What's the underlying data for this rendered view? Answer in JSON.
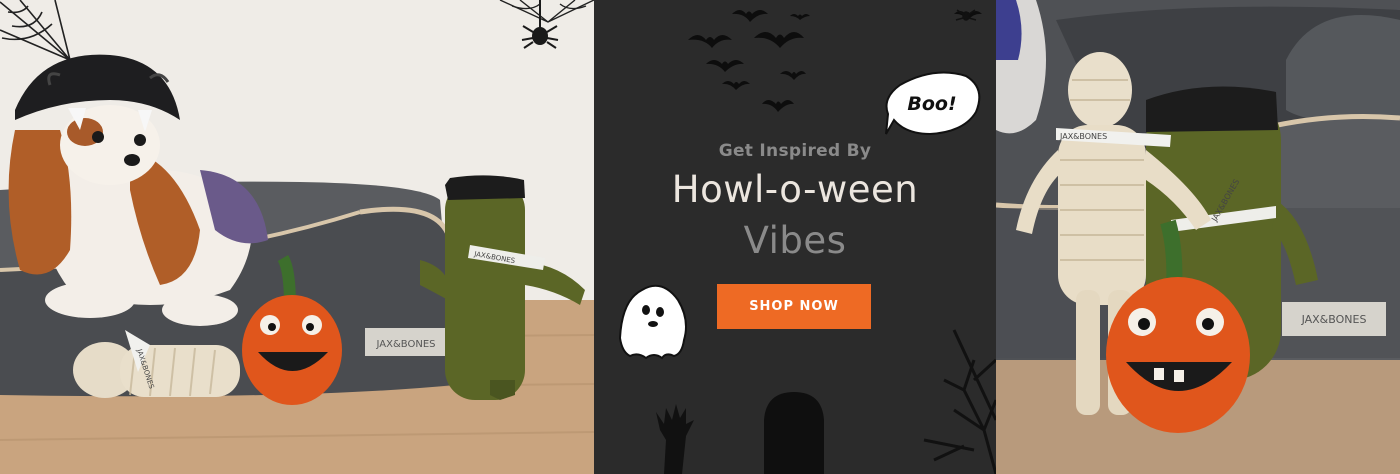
{
  "hero": {
    "eyebrow": "Get Inspired By",
    "title_line1": "Howl-o-ween",
    "title_line2": "Vibes",
    "cta_label": "SHOP NOW"
  },
  "boo_bubble": {
    "text": "Boo!"
  },
  "brand_tags": {
    "bed_left": "JAX&BONES",
    "ribbon_frank": "JAX&BONES",
    "ribbon_mummy_left": "JAX&BONES",
    "ribbon_mummy_right": "JAX&BONES",
    "ribbon_frank_right": "JAX&BONES",
    "bed_right": "JAX&BONES"
  },
  "colors": {
    "accent_orange": "#ee6a24",
    "panel_dark": "#2b2b2b",
    "title_light": "#ece6df",
    "title_muted": "#8a8a8a"
  },
  "icons": [
    "bat-icon",
    "spider-icon",
    "spider-web-icon",
    "ghost-icon",
    "boo-speech-bubble-icon",
    "zombie-hand-icon",
    "tombstone-icon",
    "dead-tree-icon"
  ]
}
